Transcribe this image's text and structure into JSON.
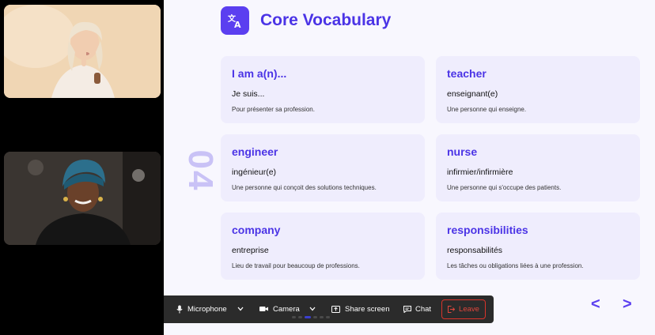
{
  "slide": {
    "title": "Core Vocabulary",
    "section_number": "04",
    "title_icon": "translate-icon",
    "cards": [
      {
        "english": "I am a(n)...",
        "french": "Je suis...",
        "definition": "Pour présenter sa profession."
      },
      {
        "english": "teacher",
        "french": "enseignant(e)",
        "definition": "Une personne qui enseigne."
      },
      {
        "english": "engineer",
        "french": "ingénieur(e)",
        "definition": "Une personne qui conçoit des solutions techniques."
      },
      {
        "english": "nurse",
        "french": "infirmier/infirmière",
        "definition": "Une personne qui s'occupe des patients."
      },
      {
        "english": "company",
        "french": "entreprise",
        "definition": "Lieu de travail pour beaucoup de professions."
      },
      {
        "english": "responsibilities",
        "french": "responsabilités",
        "definition": "Les tâches ou obligations liées à une profession."
      }
    ],
    "nav": {
      "prev": "<",
      "next": ">"
    }
  },
  "toolbar": {
    "microphone": "Microphone",
    "camera": "Camera",
    "share_screen": "Share screen",
    "chat": "Chat",
    "leave": "Leave"
  },
  "colors": {
    "accent": "#4b34e6",
    "card_bg": "#efedfd",
    "leave": "#d9342b",
    "toolbar_bg": "#2b2b2b"
  }
}
